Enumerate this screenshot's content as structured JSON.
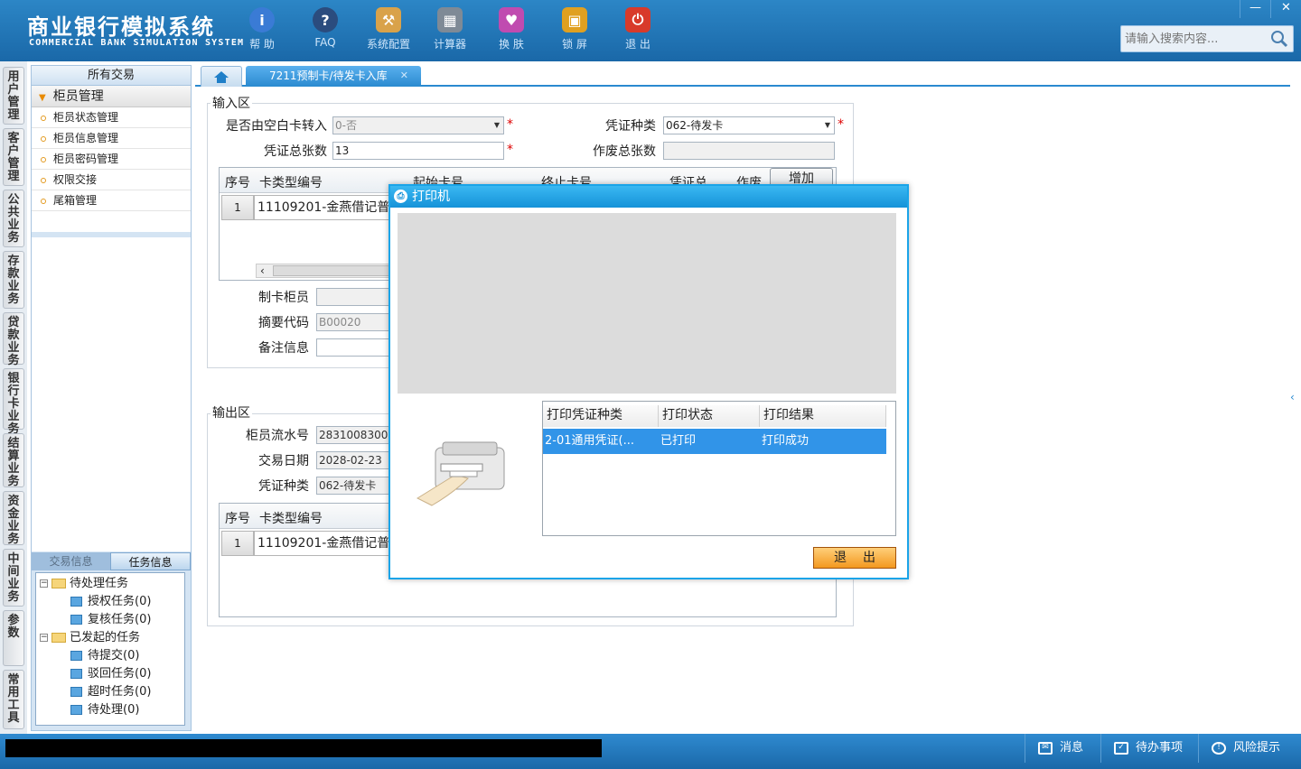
{
  "app": {
    "title_cn": "商业银行模拟系统",
    "title_en": "COMMERCIAL BANK SIMULATION SYSTEM"
  },
  "toolbar": [
    {
      "label": "帮 助",
      "icon": "info-icon",
      "glyph": "i",
      "color": "#3a7bd5"
    },
    {
      "label": "FAQ",
      "icon": "question-icon",
      "glyph": "?",
      "color": "#2b4c7e"
    },
    {
      "label": "系统配置",
      "icon": "toolbox-icon",
      "glyph": "⚒",
      "color": "#d9a24a"
    },
    {
      "label": "计算器",
      "icon": "calculator-icon",
      "glyph": "▦",
      "color": "#7f8a96"
    },
    {
      "label": "换 肤",
      "icon": "shirt-icon",
      "glyph": "♥",
      "color": "#c04bb0"
    },
    {
      "label": "锁 屏",
      "icon": "lock-icon",
      "glyph": "🔒",
      "color": "#e0a020"
    },
    {
      "label": "退 出",
      "icon": "power-icon",
      "glyph": "⏻",
      "color": "#d83a2a"
    }
  ],
  "window_buttons": {
    "minimize": "—",
    "close": "✕"
  },
  "search": {
    "placeholder": "请输入搜索内容..."
  },
  "vtabs": [
    "用户管理",
    "客户管理",
    "公共业务",
    "存款业务",
    "贷款业务",
    "银行卡业务",
    "结算业务",
    "资金业务",
    "中间业务",
    "参数",
    "常用工具"
  ],
  "left_panel": {
    "header": "所有交易",
    "group": "柜员管理",
    "items": [
      "柜员状态管理",
      "柜员信息管理",
      "柜员密码管理",
      "权限交接",
      "尾箱管理"
    ],
    "bottom_tabs": [
      "交易信息",
      "任务信息"
    ],
    "tree": {
      "pending": "待处理任务",
      "pending_children": [
        "授权任务(0)",
        "复核任务(0)"
      ],
      "initiated": "已发起的任务",
      "initiated_children": [
        "待提交(0)",
        "驳回任务(0)",
        "超时任务(0)",
        "待处理(0)"
      ]
    }
  },
  "tabs": {
    "active": "7211预制卡/待发卡入库",
    "close": "✕"
  },
  "input_area": {
    "legend": "输入区",
    "from_blank_label": "是否由空白卡转入",
    "from_blank_value": "0-否",
    "voucher_type_label": "凭证种类",
    "voucher_type_value": "062-待发卡",
    "total_label": "凭证总张数",
    "total_value": "13",
    "void_label": "作废总张数",
    "void_value": "",
    "grid_headers": [
      "序号",
      "卡类型编号",
      "起始卡号",
      "终止卡号",
      "凭证总",
      "作废"
    ],
    "grid_row": {
      "num": "1",
      "card_type": "11109201-金燕借记普..."
    },
    "add_button": "增加",
    "scroll_left": "‹",
    "maker_label": "制卡柜员",
    "maker_value": "",
    "summary_label": "摘要代码",
    "summary_value": "B00020",
    "remark_label": "备注信息",
    "remark_value": ""
  },
  "output_area": {
    "legend": "输出区",
    "serial_label": "柜员流水号",
    "serial_value": "283100830000",
    "date_label": "交易日期",
    "date_value": "2028-02-23",
    "voucher_label": "凭证种类",
    "voucher_value": "062-待发卡",
    "grid_headers": [
      "序号",
      "卡类型编号"
    ],
    "grid_row": {
      "num": "1",
      "card_type": "11109201-金燕借记普通"
    }
  },
  "dialog": {
    "title": "打印机",
    "table_headers": [
      "打印凭证种类",
      "打印状态",
      "打印结果"
    ],
    "row": {
      "type": "2-01通用凭证(...",
      "status": "已打印",
      "result": "打印成功"
    },
    "exit_button": "退出"
  },
  "statusbar": {
    "messages": "消息",
    "todo": "待办事项",
    "risk": "风险提示"
  }
}
